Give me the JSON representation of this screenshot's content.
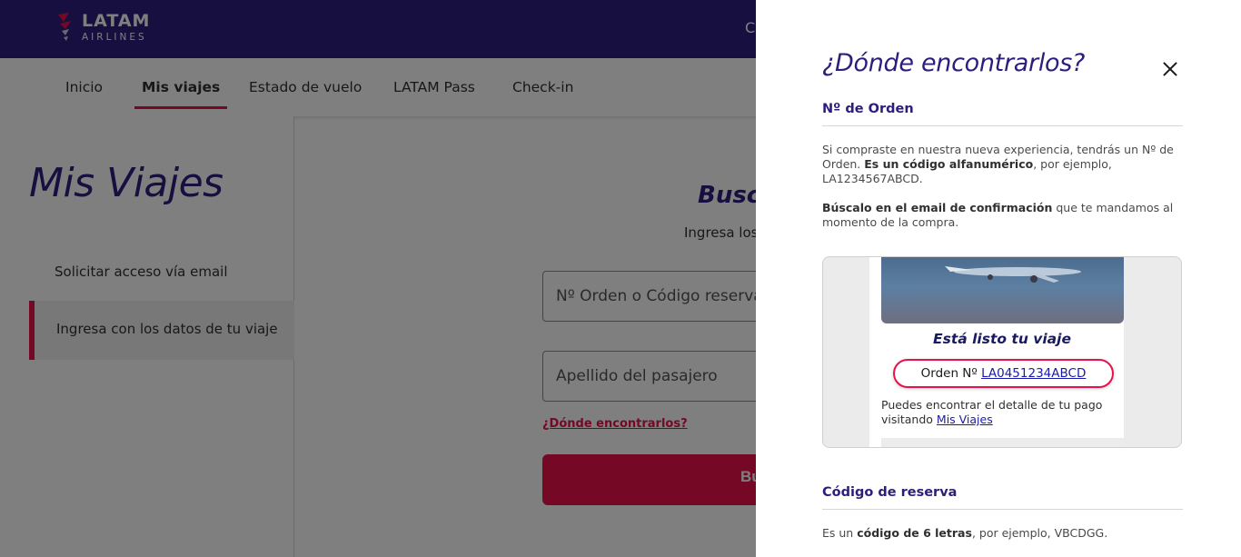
{
  "brand": {
    "name": "LATAM",
    "sub": "AIRLINES"
  },
  "topbar": {
    "right_text": "Co"
  },
  "nav": {
    "items": [
      {
        "label": "Inicio"
      },
      {
        "label": "Mis viajes"
      },
      {
        "label": "Estado de vuelo"
      },
      {
        "label": "LATAM Pass"
      },
      {
        "label": "Check-in"
      }
    ]
  },
  "sidebar": {
    "title": "Mis Viajes",
    "items": [
      {
        "label": "Solicitar acceso vía email"
      },
      {
        "label": "Ingresa con los datos de tu viaje"
      }
    ]
  },
  "main": {
    "title": "Busca",
    "subtitle": "Ingresa los",
    "order_placeholder": "Nº Orden o Código reserva",
    "lastname_placeholder": "Apellido del pasajero",
    "where_link": "¿Dónde encontrarlos?",
    "search_button": "Bu"
  },
  "drawer": {
    "title": "¿Dónde encontrarlos?",
    "order_section": {
      "heading": "Nº de Orden",
      "p1_before": "Si compraste en nuestra nueva experiencia, tendrás un Nº de Orden. ",
      "p1_bold": "Es un código alfanumérico",
      "p1_after": ", por ejemplo, LA1234567ABCD.",
      "p2_bold": "Búscalo en el email de confirmación",
      "p2_after": " que te mandamos al momento de la compra."
    },
    "email_example": {
      "heading": "Está listo tu viaje",
      "order_label": "Orden Nº",
      "order_number": "LA0451234ABCD",
      "detail_text": "Puedes encontrar el detalle de tu pago visitando",
      "detail_link": "Mis Viajes"
    },
    "booking_section": {
      "heading": "Código de reserva",
      "p_before": "Es un ",
      "p_bold": "código de 6 letras",
      "p_after": ", por ejemplo, VBCDGG."
    }
  },
  "colors": {
    "brand_indigo": "#2d1e7e",
    "brand_coral": "#e8114b",
    "link_blue": "#1b1baa"
  }
}
